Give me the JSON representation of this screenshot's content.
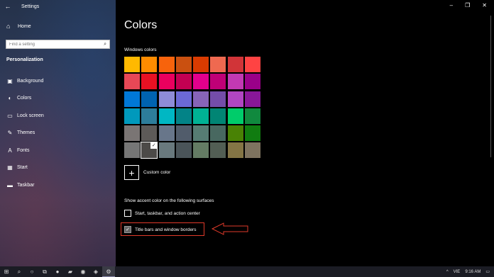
{
  "window": {
    "app_title": "Settings",
    "back_icon": "←",
    "minimize_icon": "–",
    "restore_icon": "❐",
    "close_icon": "✕"
  },
  "sidebar": {
    "home_label": "Home",
    "search_placeholder": "Find a setting",
    "section_title": "Personalization",
    "items": [
      {
        "label": "Background",
        "icon": "▣"
      },
      {
        "label": "Colors",
        "icon": "◐"
      },
      {
        "label": "Lock screen",
        "icon": "▭"
      },
      {
        "label": "Themes",
        "icon": "✎"
      },
      {
        "label": "Fonts",
        "icon": "A"
      },
      {
        "label": "Start",
        "icon": "▦"
      },
      {
        "label": "Taskbar",
        "icon": "▬"
      }
    ]
  },
  "main": {
    "page_title": "Colors",
    "windows_colors_label": "Windows colors",
    "palette": [
      [
        "#ffb900",
        "#ff8c00",
        "#f7630c",
        "#ca5010",
        "#da3b01",
        "#ef6950",
        "#d13438",
        "#ff4343"
      ],
      [
        "#e74856",
        "#e81123",
        "#ea005e",
        "#c30052",
        "#e3008c",
        "#bf0077",
        "#c239b3",
        "#9a0089"
      ],
      [
        "#0078d7",
        "#0063b1",
        "#8e8cd8",
        "#6b69d6",
        "#8764b8",
        "#744da9",
        "#b146c2",
        "#881798"
      ],
      [
        "#0099bc",
        "#2d7d9a",
        "#00b7c3",
        "#038387",
        "#00b294",
        "#018574",
        "#00cc6a",
        "#10893e"
      ],
      [
        "#7a7574",
        "#5d5a58",
        "#68768a",
        "#515c6b",
        "#567c73",
        "#486860",
        "#498205",
        "#107c10"
      ],
      [
        "#767676",
        "#4c4a48",
        "#69797e",
        "#4a5459",
        "#647c64",
        "#525e54",
        "#847545",
        "#7e735f"
      ]
    ],
    "selected_swatch": {
      "row": 5,
      "col": 1
    },
    "check_mark": "✓",
    "custom_color_icon": "+",
    "custom_color_label": "Custom color",
    "surfaces_label": "Show accent color on the following surfaces",
    "option_start_label": "Start, taskbar, and action center",
    "option_start_checked": false,
    "option_titlebars_label": "Title bars and window borders",
    "option_titlebars_checked": true,
    "highlight_color": "#e03a2a"
  },
  "taskbar": {
    "start_icon": "⊞",
    "search_icon": "⌕",
    "cortana_icon": "○",
    "taskview_icon": "⧉",
    "spotify_icon": "●",
    "explorer_icon": "▰",
    "chrome_icon": "◉",
    "store_icon": "◈",
    "settings_icon": "⚙",
    "tray_chevron": "^",
    "language": "VIE",
    "time": "9:16 AM",
    "notification_icon": "▭"
  }
}
